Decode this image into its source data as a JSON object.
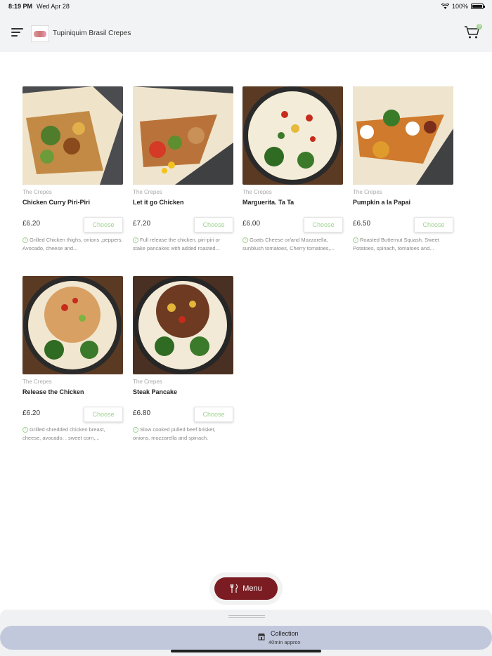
{
  "status_bar": {
    "time": "8:19 PM",
    "date": "Wed Apr 28",
    "battery": "100%",
    "battery_level": 1.0,
    "icons": [
      "wifi-icon",
      "battery-icon"
    ]
  },
  "header": {
    "brand": "Tupiniquim Brasil Crepes",
    "menu_icon": "hamburger-menu-icon",
    "cart_icon": "shopping-cart-icon",
    "cart_badge": "0"
  },
  "products": [
    {
      "category": "The Crepes",
      "name": "Chicken Curry Piri-Piri",
      "price": "£6.20",
      "button": "Choose",
      "description": "Grilled Chicken thighs, onions ,peppers, Avocado, cheese and..."
    },
    {
      "category": "The Crepes",
      "name": "Let it go Chicken",
      "price": "£7.20",
      "button": "Choose",
      "description": "Full release the chicken, piri-piri or stake pancakes with added roasted..."
    },
    {
      "category": "The Crepes",
      "name": "Marguerita. Ta Ta",
      "price": "£6.00",
      "button": "Choose",
      "description": "Goats Cheese or/and Mozzarella, sunblush tomatoes, Cherry tomatoes,..."
    },
    {
      "category": "The Crepes",
      "name": "Pumpkin a la Papai",
      "price": "£6.50",
      "button": "Choose",
      "description": "Roasted Butternut Squash, Sweet Potatoes, spinach, tomatoes and..."
    },
    {
      "category": "The Crepes",
      "name": "Release the Chicken",
      "price": "£6.20",
      "button": "Choose",
      "description": "Grilled shredded chicken breast, cheese, avocado, . sweet corn,..."
    },
    {
      "category": "The Crepes",
      "name": "Steak Pancake",
      "price": "£6.80",
      "button": "Choose",
      "description": "Slow cooked pulled beef brisket, onions, mozzarella and spinach."
    }
  ],
  "menu_button": {
    "label": "Menu",
    "icon": "fork-knife-icon"
  },
  "collection": {
    "title": "Collection",
    "subtitle": "40min approx",
    "icon": "shop-icon"
  },
  "colors": {
    "accent": "#9fd38f",
    "menu_button": "#7a1c22",
    "collection_bar": "#c2c8dc"
  }
}
